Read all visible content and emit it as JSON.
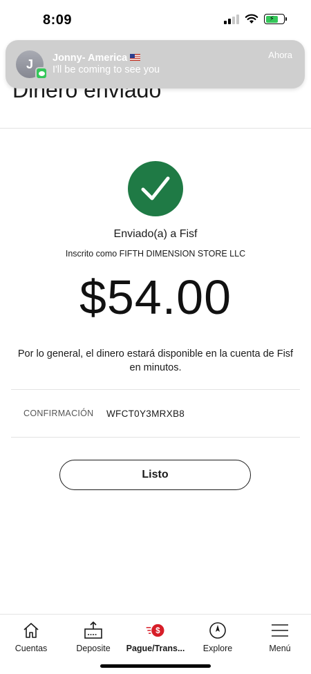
{
  "status_bar": {
    "time": "8:09"
  },
  "notification": {
    "avatar_initial": "J",
    "sender": "Jonny- America",
    "message": "I'll be coming to see you",
    "time": "Ahora",
    "flag_icon": "us-flag-icon"
  },
  "page": {
    "title": "Dinero enviado"
  },
  "confirmation_screen": {
    "success_icon": "checkmark-icon",
    "success_color": "#1f7a45",
    "sent_to": "Enviado(a) a Fisf",
    "enrolled_as": "Inscrito como FIFTH DIMENSION STORE LLC",
    "amount": "$54.00",
    "availability_note": "Por lo general, el dinero estará disponible en la cuenta de Fisf en minutos.",
    "confirmation_label": "CONFIRMACIÓN",
    "confirmation_code": "WFCT0Y3MRXB8",
    "done_label": "Listo"
  },
  "tabbar": {
    "accent_color": "#d71e28",
    "items": [
      {
        "label": "Cuentas",
        "icon": "home-icon",
        "active": false
      },
      {
        "label": "Deposite",
        "icon": "deposit-icon",
        "active": false
      },
      {
        "label": "Pague/Trans...",
        "icon": "pay-transfer-icon",
        "active": true
      },
      {
        "label": "Explore",
        "icon": "compass-icon",
        "active": false
      },
      {
        "label": "Menú",
        "icon": "menu-icon",
        "active": false
      }
    ]
  }
}
